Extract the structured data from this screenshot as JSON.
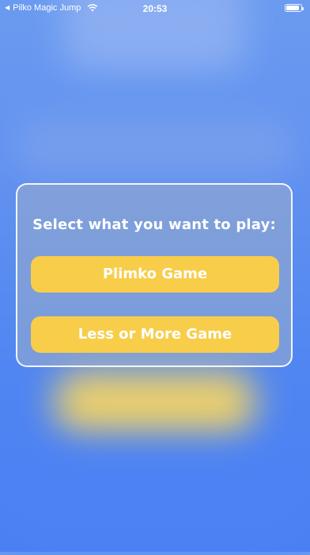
{
  "status_bar": {
    "back_app_label": "Pilko Magic Jump",
    "time": "20:53"
  },
  "dialog": {
    "title": "Select what you want to play:",
    "buttons": [
      {
        "label": "Plimko Game"
      },
      {
        "label": "Less or More Game"
      }
    ]
  },
  "colors": {
    "button": "#f7cd4a",
    "background": "#5e8ff0",
    "text": "#ffffff"
  }
}
